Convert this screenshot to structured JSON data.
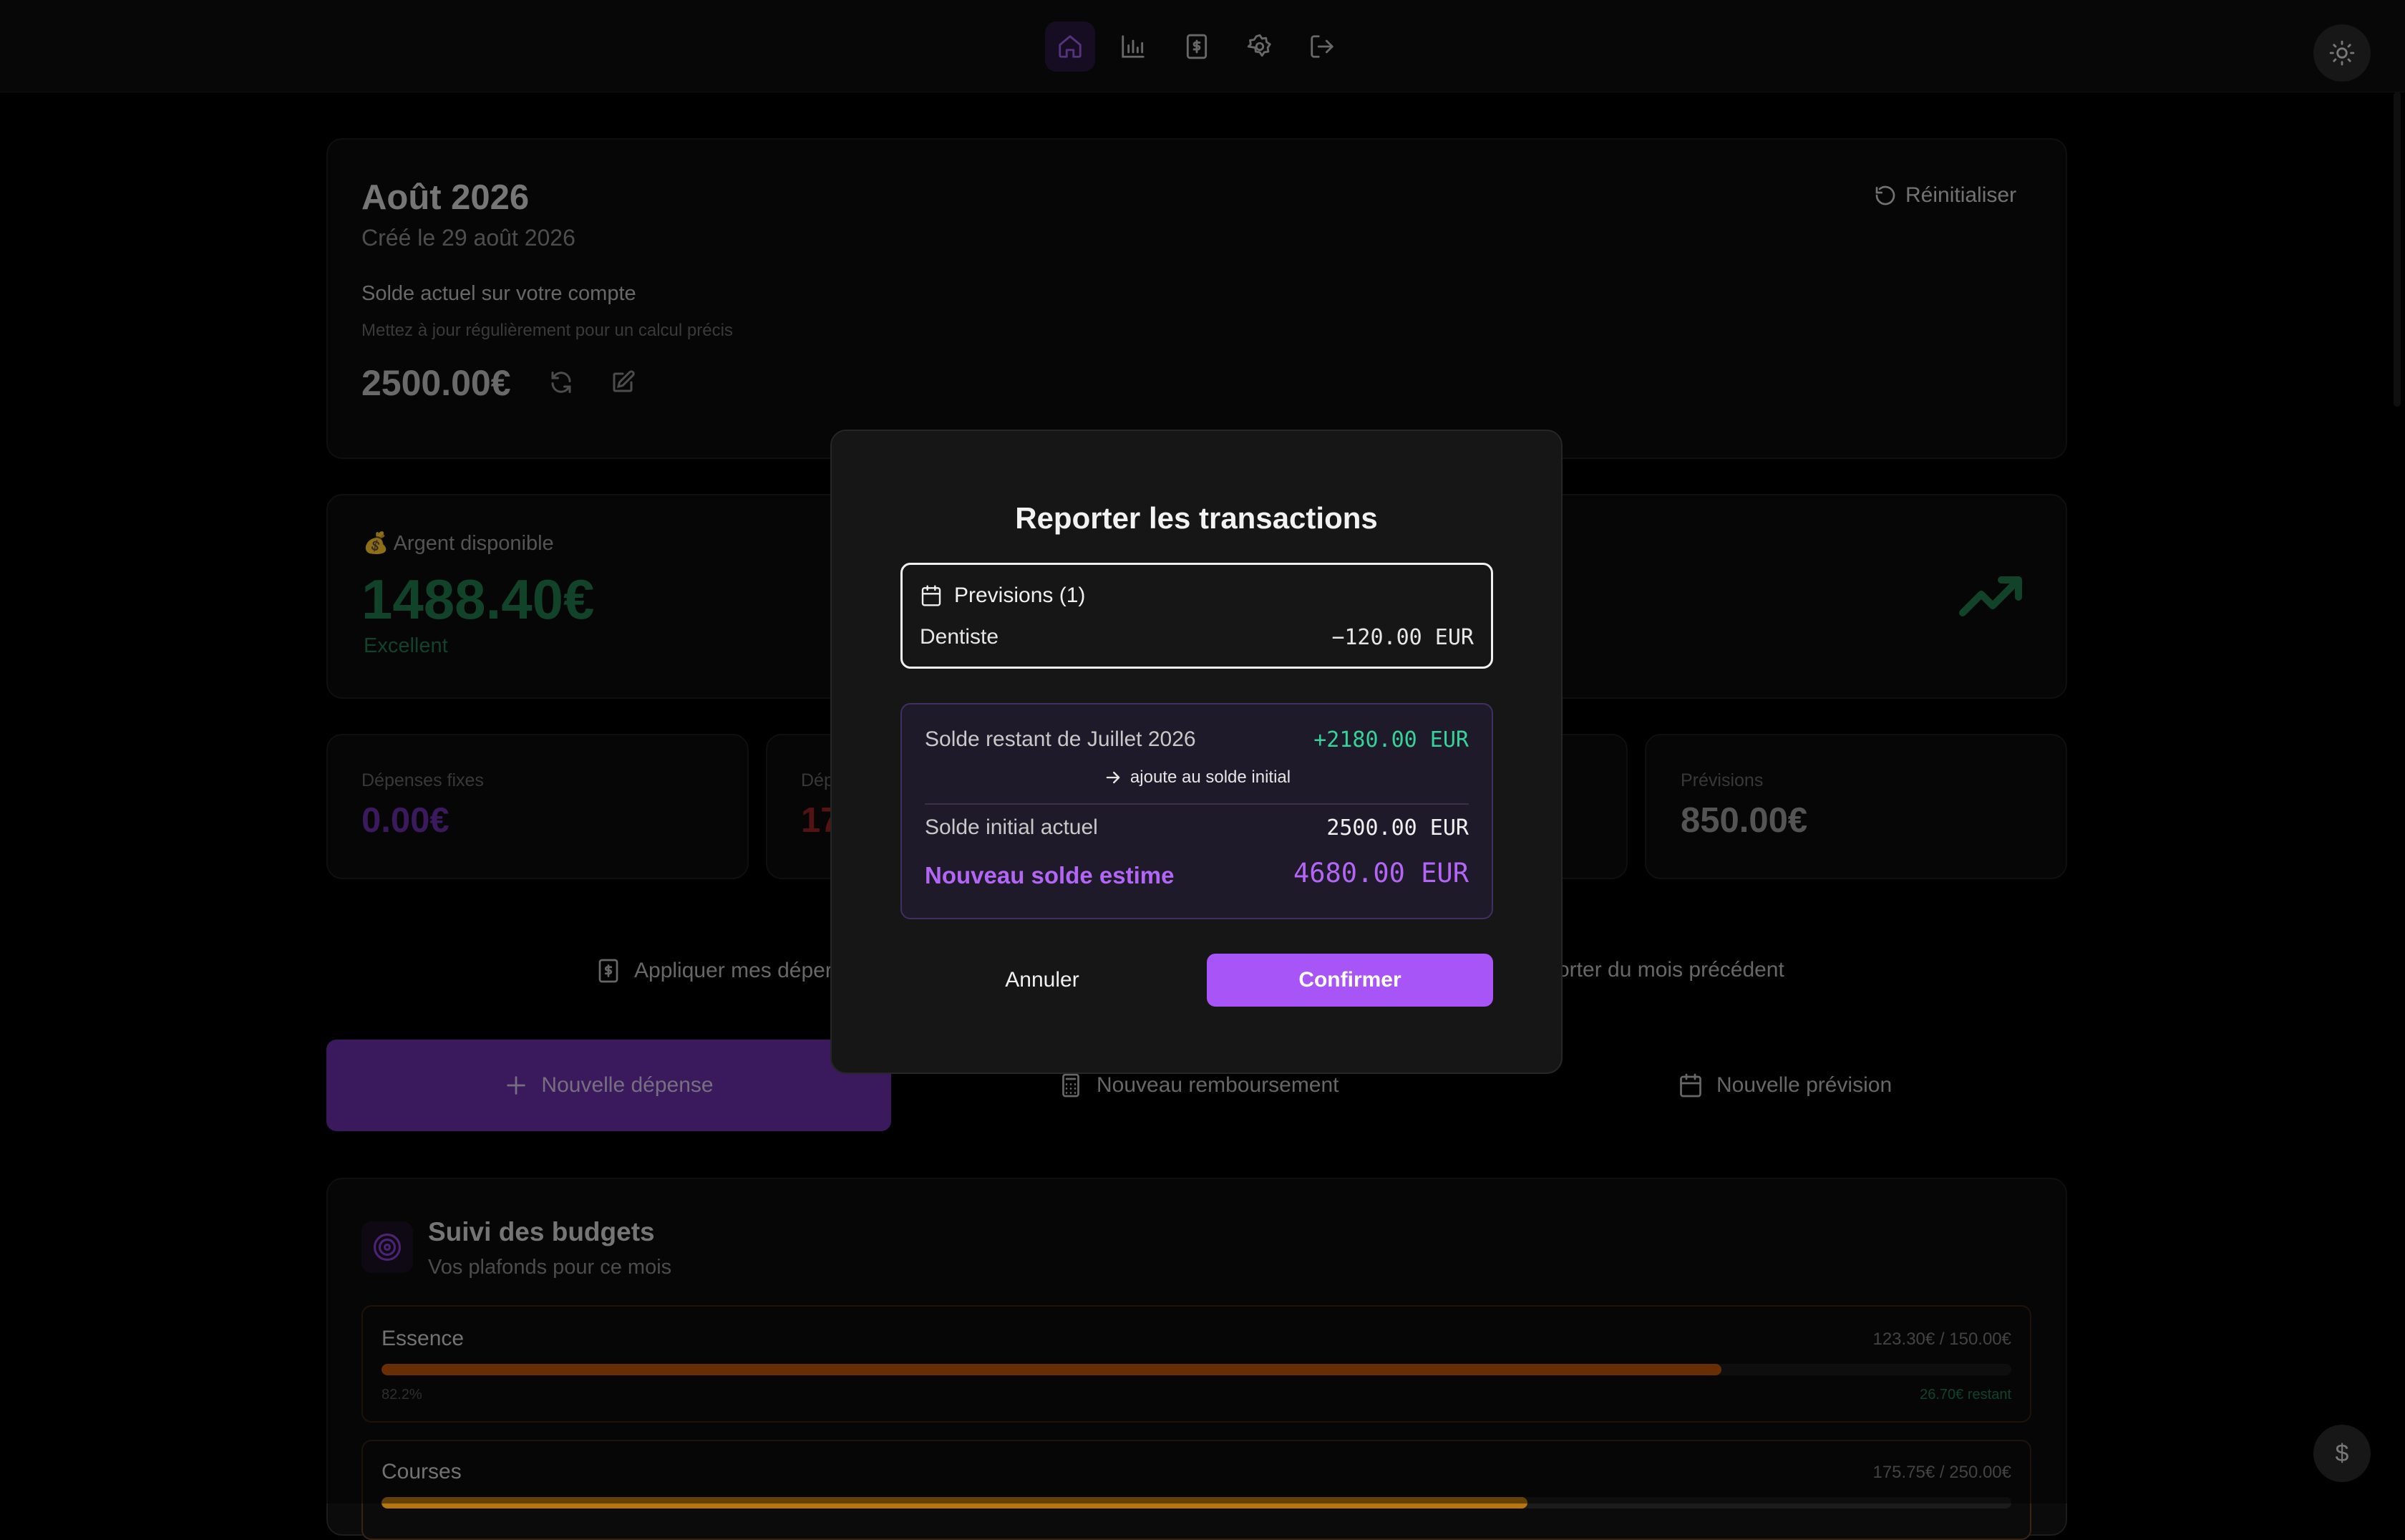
{
  "nav": {
    "items": [
      {
        "name": "home-icon",
        "active": true
      },
      {
        "name": "bar-chart-icon",
        "active": false
      },
      {
        "name": "dollar-file-icon",
        "active": false
      },
      {
        "name": "gear-icon",
        "active": false
      },
      {
        "name": "logout-icon",
        "active": false
      }
    ],
    "theme_toggle_icon": "sun-icon"
  },
  "month_card": {
    "title": "Août 2026",
    "created": "Créé le 29 août 2026",
    "reset_label": "Réinitialiser",
    "balance_label": "Solde actuel sur votre compte",
    "balance_hint": "Mettez à jour régulièrement pour un calcul précis",
    "balance_value": "2500.00€"
  },
  "available": {
    "label": "💰 Argent disponible",
    "value": "1488.40€",
    "status": "Excellent"
  },
  "stats": [
    {
      "label": "Dépenses fixes",
      "value": "0.00€",
      "color": "#6b2fa8"
    },
    {
      "label": "Dép",
      "value": "17",
      "color": "#9a2424"
    },
    {
      "label": "Prévisions",
      "value": "850.00€",
      "color": "#9a9a9a"
    }
  ],
  "actions": {
    "apply_fixed": "Appliquer mes déper",
    "carry_over": "orter du mois précédent",
    "new_expense": "Nouvelle dépense",
    "new_refund": "Nouveau remboursement",
    "new_forecast": "Nouvelle prévision"
  },
  "budgets": {
    "title": "Suivi des budgets",
    "subtitle": "Vos plafonds pour ce mois",
    "items": [
      {
        "name": "Essence",
        "amount": "123.30€ / 150.00€",
        "percent": "82.2%",
        "progress": 0.822,
        "remaining": "26.70€ restant",
        "color": "#c2540a"
      },
      {
        "name": "Courses",
        "amount": "175.75€ / 250.00€",
        "progress": 0.703,
        "color": "#b5770d"
      }
    ]
  },
  "fab_symbol": "$",
  "modal": {
    "title": "Reporter les transactions",
    "forecast_header": "Previsions (1)",
    "forecast_items": [
      {
        "name": "Dentiste",
        "amount": "−120.00 EUR"
      }
    ],
    "remaining_label": "Solde restant de Juillet 2026",
    "remaining_value": "+2180.00 EUR",
    "remaining_note": "ajoute au solde initial",
    "initial_label": "Solde initial actuel",
    "initial_value": "2500.00 EUR",
    "new_label": "Nouveau solde estime",
    "new_value": "4680.00 EUR",
    "cancel_label": "Annuler",
    "confirm_label": "Confirmer",
    "accent_color": "#a855f7",
    "positive_color": "#34d399"
  }
}
